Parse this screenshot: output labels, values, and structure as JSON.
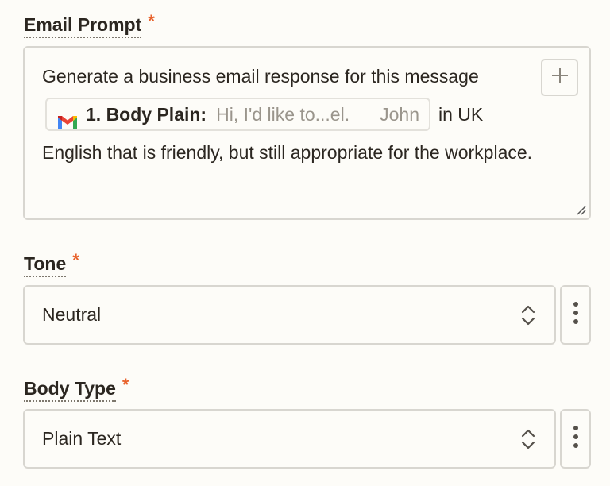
{
  "email_prompt": {
    "label": "Email Prompt",
    "required_mark": "*",
    "text_before": "Generate a business email response for this message",
    "pill": {
      "icon": "gmail-icon",
      "label": "1. Body Plain:",
      "preview": "Hi, I'd like to...el.",
      "name": "John"
    },
    "text_after_pill": "in UK",
    "text_rest": "English that is friendly, but still appropriate for the workplace.",
    "insert_icon": "plus-icon"
  },
  "tone": {
    "label": "Tone",
    "required_mark": "*",
    "value": "Neutral",
    "chevron_icon": "up-down-chevron-icon",
    "more_icon": "vertical-ellipsis-icon"
  },
  "body_type": {
    "label": "Body Type",
    "required_mark": "*",
    "value": "Plain Text",
    "chevron_icon": "up-down-chevron-icon",
    "more_icon": "vertical-ellipsis-icon"
  },
  "colors": {
    "background": "#fdfcf8",
    "border": "#d8d6d0",
    "required": "#e8622c",
    "text": "#2b2620",
    "muted": "#9a958c"
  }
}
